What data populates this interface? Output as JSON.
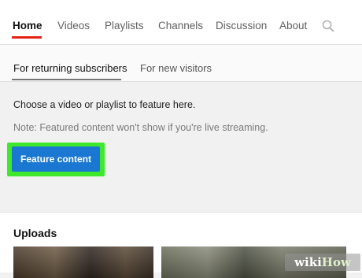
{
  "nav": {
    "tabs": [
      {
        "label": "Home",
        "active": true
      },
      {
        "label": "Videos"
      },
      {
        "label": "Playlists"
      },
      {
        "label": "Channels"
      },
      {
        "label": "Discussion"
      },
      {
        "label": "About"
      }
    ],
    "search_icon": "search-icon"
  },
  "subtabs": [
    {
      "label": "For returning subscribers",
      "active": true
    },
    {
      "label": "For new visitors"
    }
  ],
  "featured": {
    "prompt": "Choose a video or playlist to feature here.",
    "note": "Note: Featured content won't show if you're live streaming.",
    "button_label": "Feature content"
  },
  "uploads": {
    "title": "Uploads"
  },
  "watermark": {
    "part1": "wiki",
    "part2": "How"
  },
  "colors": {
    "accent_red": "#e62117",
    "button_blue": "#1a78d3",
    "highlight_green": "#3ee82b"
  }
}
